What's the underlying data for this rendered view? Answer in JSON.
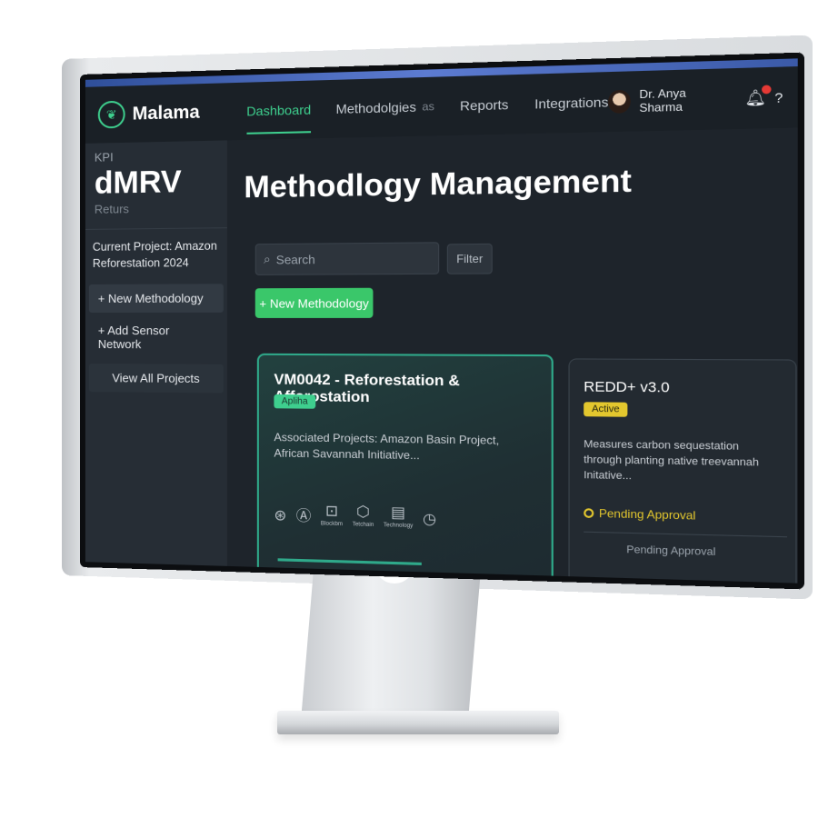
{
  "app": {
    "brand": "Malama"
  },
  "nav": {
    "items": [
      {
        "label": "Dashboard"
      },
      {
        "label": "Methodolgies"
      },
      {
        "label": "Reports"
      },
      {
        "label": "Integrations"
      }
    ],
    "methodolgies_suffix": "as"
  },
  "user": {
    "name": "Dr. Anya Sharma",
    "help": "?"
  },
  "sidebar": {
    "kpi": "KPI",
    "big": "dMRV",
    "sub": "Returs",
    "current_project": "Current Project: Amazon Reforestation 2024",
    "new_methodology": "+ New Methodology",
    "add_sensor": "+ Add Sensor Network",
    "view_all": "View All Projects"
  },
  "main": {
    "title": "Methodlogy Management",
    "search_placeholder": "Search",
    "filter_label": "Filter",
    "new_button": "+ New Methodology"
  },
  "cards": [
    {
      "title": "VM0042 - Reforestation & Afforostation",
      "badge": "Apliha",
      "desc": "Associated Projects: Amazon Basin Project, African Savannah Initiative...",
      "icons": [
        {
          "name": "brain-icon",
          "glyph": "⊛",
          "label": ""
        },
        {
          "name": "ai-icon",
          "glyph": "Ⓐ",
          "label": ""
        },
        {
          "name": "blockchain-icon",
          "glyph": "⊡",
          "label": "Blockbm"
        },
        {
          "name": "techchain-icon",
          "glyph": "⬡",
          "label": "Tetchain"
        },
        {
          "name": "technology-icon",
          "glyph": "▤",
          "label": "Technology"
        },
        {
          "name": "timer-icon",
          "glyph": "◷",
          "label": ""
        }
      ]
    },
    {
      "title": "REDD+ v3.0",
      "badge": "Active",
      "desc": "Measures carbon sequestation through planting native treevannah Initative...",
      "status": "Pending Approval",
      "status2": "Pending Approval"
    }
  ],
  "colors": {
    "accent": "#3ecf8e",
    "warning": "#e3c72e",
    "bg": "#1e242b"
  }
}
